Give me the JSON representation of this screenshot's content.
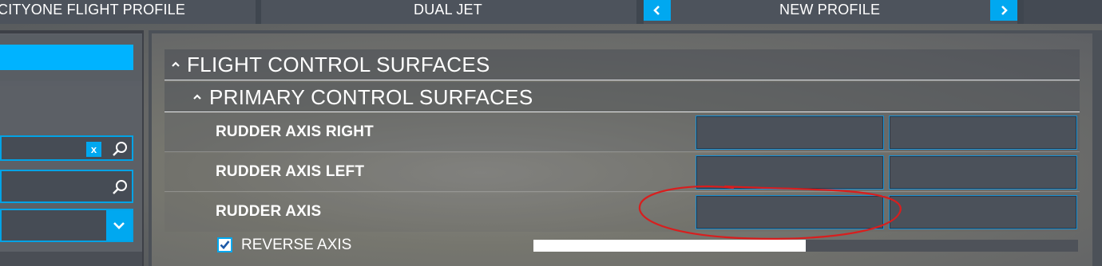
{
  "topbar": {
    "profile_name": "CITYONE FLIGHT PROFILE",
    "controller_mode": "DUAL JET",
    "preset_name": "NEW PROFILE",
    "icons": {
      "prev": "chevron-left-icon",
      "next": "chevron-right-icon"
    }
  },
  "left_panel": {
    "search_clear_label": "x",
    "icons": {
      "search": "search-icon",
      "dropdown": "chevron-down-icon"
    }
  },
  "main": {
    "section_title": "FLIGHT CONTROL SURFACES",
    "subsection_title": "PRIMARY CONTROL SURFACES",
    "rows": [
      {
        "label": "RUDDER AXIS RIGHT",
        "binding_1": "",
        "binding_2": ""
      },
      {
        "label": "RUDDER AXIS LEFT",
        "binding_1": "",
        "binding_2": ""
      },
      {
        "label": "RUDDER AXIS",
        "binding_1": "",
        "binding_2": ""
      }
    ],
    "reverse_axis": {
      "label": "REVERSE AXIS",
      "checked": true
    },
    "axis_level": 0.5
  },
  "colors": {
    "accent": "#00a8f0",
    "annotation": "#d81e1e"
  }
}
